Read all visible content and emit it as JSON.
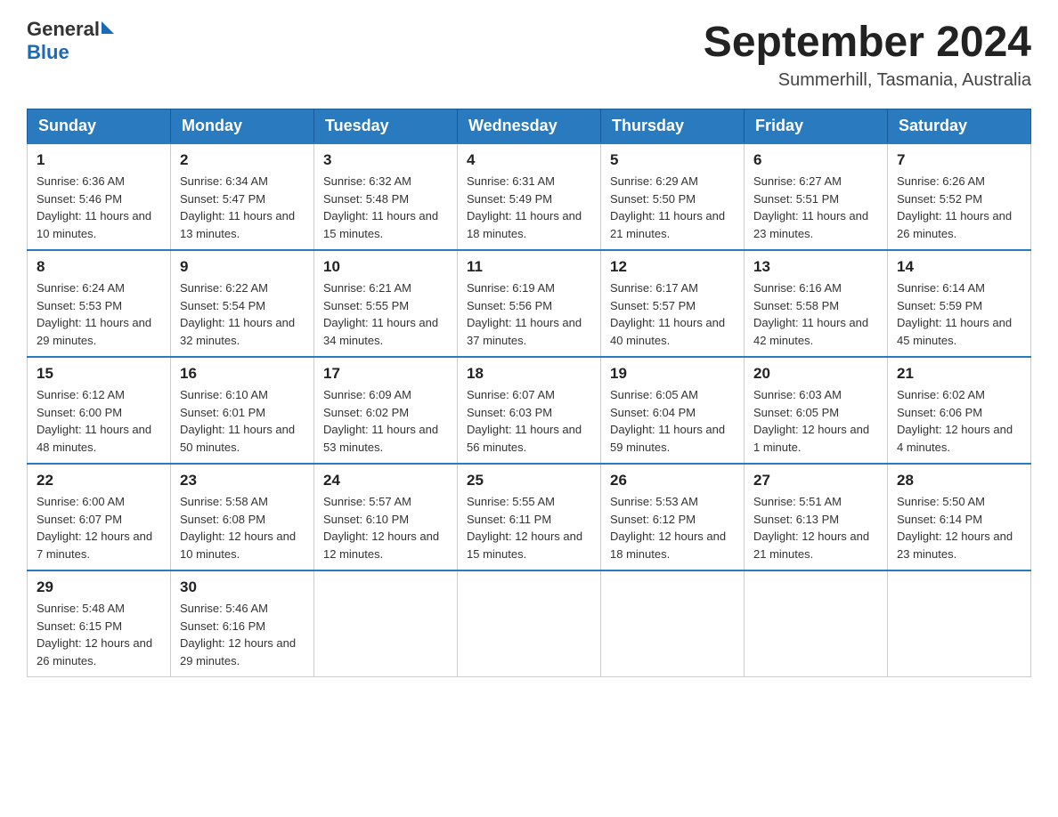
{
  "logo": {
    "general": "General",
    "blue": "Blue"
  },
  "title": "September 2024",
  "location": "Summerhill, Tasmania, Australia",
  "headers": [
    "Sunday",
    "Monday",
    "Tuesday",
    "Wednesday",
    "Thursday",
    "Friday",
    "Saturday"
  ],
  "weeks": [
    [
      {
        "day": "1",
        "sunrise": "6:36 AM",
        "sunset": "5:46 PM",
        "daylight": "11 hours and 10 minutes."
      },
      {
        "day": "2",
        "sunrise": "6:34 AM",
        "sunset": "5:47 PM",
        "daylight": "11 hours and 13 minutes."
      },
      {
        "day": "3",
        "sunrise": "6:32 AM",
        "sunset": "5:48 PM",
        "daylight": "11 hours and 15 minutes."
      },
      {
        "day": "4",
        "sunrise": "6:31 AM",
        "sunset": "5:49 PM",
        "daylight": "11 hours and 18 minutes."
      },
      {
        "day": "5",
        "sunrise": "6:29 AM",
        "sunset": "5:50 PM",
        "daylight": "11 hours and 21 minutes."
      },
      {
        "day": "6",
        "sunrise": "6:27 AM",
        "sunset": "5:51 PM",
        "daylight": "11 hours and 23 minutes."
      },
      {
        "day": "7",
        "sunrise": "6:26 AM",
        "sunset": "5:52 PM",
        "daylight": "11 hours and 26 minutes."
      }
    ],
    [
      {
        "day": "8",
        "sunrise": "6:24 AM",
        "sunset": "5:53 PM",
        "daylight": "11 hours and 29 minutes."
      },
      {
        "day": "9",
        "sunrise": "6:22 AM",
        "sunset": "5:54 PM",
        "daylight": "11 hours and 32 minutes."
      },
      {
        "day": "10",
        "sunrise": "6:21 AM",
        "sunset": "5:55 PM",
        "daylight": "11 hours and 34 minutes."
      },
      {
        "day": "11",
        "sunrise": "6:19 AM",
        "sunset": "5:56 PM",
        "daylight": "11 hours and 37 minutes."
      },
      {
        "day": "12",
        "sunrise": "6:17 AM",
        "sunset": "5:57 PM",
        "daylight": "11 hours and 40 minutes."
      },
      {
        "day": "13",
        "sunrise": "6:16 AM",
        "sunset": "5:58 PM",
        "daylight": "11 hours and 42 minutes."
      },
      {
        "day": "14",
        "sunrise": "6:14 AM",
        "sunset": "5:59 PM",
        "daylight": "11 hours and 45 minutes."
      }
    ],
    [
      {
        "day": "15",
        "sunrise": "6:12 AM",
        "sunset": "6:00 PM",
        "daylight": "11 hours and 48 minutes."
      },
      {
        "day": "16",
        "sunrise": "6:10 AM",
        "sunset": "6:01 PM",
        "daylight": "11 hours and 50 minutes."
      },
      {
        "day": "17",
        "sunrise": "6:09 AM",
        "sunset": "6:02 PM",
        "daylight": "11 hours and 53 minutes."
      },
      {
        "day": "18",
        "sunrise": "6:07 AM",
        "sunset": "6:03 PM",
        "daylight": "11 hours and 56 minutes."
      },
      {
        "day": "19",
        "sunrise": "6:05 AM",
        "sunset": "6:04 PM",
        "daylight": "11 hours and 59 minutes."
      },
      {
        "day": "20",
        "sunrise": "6:03 AM",
        "sunset": "6:05 PM",
        "daylight": "12 hours and 1 minute."
      },
      {
        "day": "21",
        "sunrise": "6:02 AM",
        "sunset": "6:06 PM",
        "daylight": "12 hours and 4 minutes."
      }
    ],
    [
      {
        "day": "22",
        "sunrise": "6:00 AM",
        "sunset": "6:07 PM",
        "daylight": "12 hours and 7 minutes."
      },
      {
        "day": "23",
        "sunrise": "5:58 AM",
        "sunset": "6:08 PM",
        "daylight": "12 hours and 10 minutes."
      },
      {
        "day": "24",
        "sunrise": "5:57 AM",
        "sunset": "6:10 PM",
        "daylight": "12 hours and 12 minutes."
      },
      {
        "day": "25",
        "sunrise": "5:55 AM",
        "sunset": "6:11 PM",
        "daylight": "12 hours and 15 minutes."
      },
      {
        "day": "26",
        "sunrise": "5:53 AM",
        "sunset": "6:12 PM",
        "daylight": "12 hours and 18 minutes."
      },
      {
        "day": "27",
        "sunrise": "5:51 AM",
        "sunset": "6:13 PM",
        "daylight": "12 hours and 21 minutes."
      },
      {
        "day": "28",
        "sunrise": "5:50 AM",
        "sunset": "6:14 PM",
        "daylight": "12 hours and 23 minutes."
      }
    ],
    [
      {
        "day": "29",
        "sunrise": "5:48 AM",
        "sunset": "6:15 PM",
        "daylight": "12 hours and 26 minutes."
      },
      {
        "day": "30",
        "sunrise": "5:46 AM",
        "sunset": "6:16 PM",
        "daylight": "12 hours and 29 minutes."
      },
      null,
      null,
      null,
      null,
      null
    ]
  ]
}
